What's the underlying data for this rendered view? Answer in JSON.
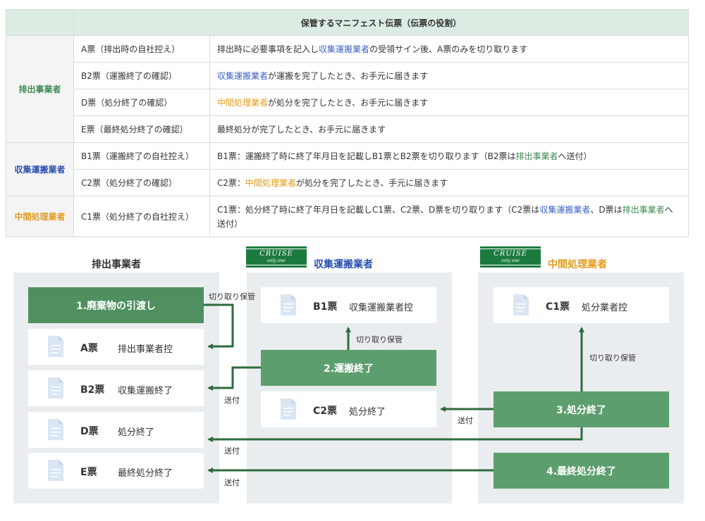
{
  "table": {
    "header": "保管するマニフェスト伝票（伝票の役割）",
    "groups": [
      {
        "role": "排出事業者",
        "rows": [
          {
            "slip": "A票（排出時の自社控え）",
            "desc": [
              {
                "t": "排出時に必要事項を記入し"
              },
              {
                "t": "収集運搬業者",
                "c": "blue"
              },
              {
                "t": "の受領サイン後、A票のみを切り取ります"
              }
            ]
          },
          {
            "slip": "B2票（運搬終了の確認）",
            "desc": [
              {
                "t": "収集運搬業者",
                "c": "blue"
              },
              {
                "t": "が運搬を完了したとき、お手元に届きます"
              }
            ]
          },
          {
            "slip": "D票（処分終了の確認）",
            "desc": [
              {
                "t": "中間処理業者",
                "c": "orange"
              },
              {
                "t": "が処分を完了したとき、お手元に届きます"
              }
            ]
          },
          {
            "slip": "E票（最終処分終了の確認）",
            "desc": [
              {
                "t": "最終処分が完了したとき、お手元に届きます"
              }
            ]
          }
        ]
      },
      {
        "role": "収集運搬業者",
        "rows": [
          {
            "slip": "B1票（運搬終了の自社控え）",
            "desc": [
              {
                "t": "B1票：運搬終了時に終了年月日を記載しB1票とB2票を切り取ります（B2票は"
              },
              {
                "t": "排出事業者",
                "c": "green"
              },
              {
                "t": "へ送付）"
              }
            ]
          },
          {
            "slip": "C2票（処分終了の確認）",
            "desc": [
              {
                "t": "C2票："
              },
              {
                "t": "中間処理業者",
                "c": "orange"
              },
              {
                "t": "が処分を完了したとき、手元に届きます"
              }
            ]
          }
        ]
      },
      {
        "role": "中間処理業者",
        "rows": [
          {
            "slip": "C1票（処分終了の自社控え）",
            "desc": [
              {
                "t": "C1票：処分終了時に終了年月日を記載しC1票、C2票、D票を切り取ります（C2票は"
              },
              {
                "t": "収集運搬業者",
                "c": "blue"
              },
              {
                "t": "、D票は"
              },
              {
                "t": "排出事業者",
                "c": "green"
              },
              {
                "t": "へ送付）"
              }
            ]
          }
        ]
      }
    ]
  },
  "diagram": {
    "columns": {
      "emitter": "排出事業者",
      "transport": "収集運搬業者",
      "processor": "中間処理業者"
    },
    "logo": {
      "name": "CRUISE",
      "tagline": "only one"
    },
    "emitter": {
      "step1": "1.廃棄物の引渡し",
      "cards": [
        {
          "code": "A票",
          "label": "排出事業者控"
        },
        {
          "code": "B2票",
          "label": "収集運搬終了"
        },
        {
          "code": "D票",
          "label": "処分終了"
        },
        {
          "code": "E票",
          "label": "最終処分終了"
        }
      ]
    },
    "transport": {
      "card_b1": {
        "code": "B1票",
        "label": "収集運搬業者控"
      },
      "step2": "2.運搬終了",
      "card_c2": {
        "code": "C2票",
        "label": "処分終了"
      }
    },
    "processor": {
      "card_c1": {
        "code": "C1票",
        "label": "処分業者控"
      },
      "step3": "3.処分終了",
      "step4": "4.最終処分終了"
    },
    "notes": {
      "cut_keep": "切り取り保管",
      "send": "送付"
    }
  },
  "colors": {
    "green_box": "#5d9e6e",
    "arrow": "#2e6b3e",
    "header_bg": "#dcece2",
    "blue_text": "#2a4fb0",
    "orange_text": "#e49b1a",
    "green_text": "#3f8a55"
  }
}
